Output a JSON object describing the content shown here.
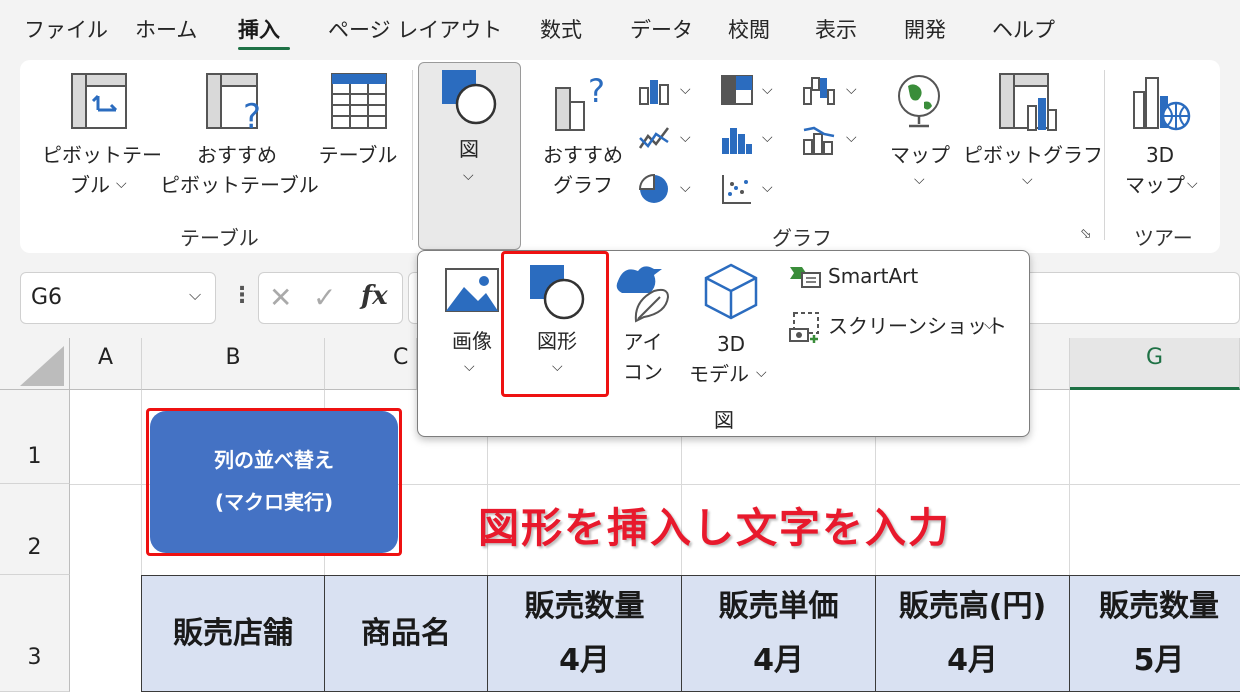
{
  "menu_tabs": [
    "ファイル",
    "ホーム",
    "挿入",
    "ページ レイアウト",
    "数式",
    "データ",
    "校閲",
    "表示",
    "開発",
    "ヘルプ"
  ],
  "active_tab": "挿入",
  "ribbon": {
    "table_group": {
      "label": "テーブル",
      "pivot_table_line1": "ピボットテー",
      "pivot_table_line2": "ブル",
      "recommended_pivot_line1": "おすすめ",
      "recommended_pivot_line2": "ピボットテーブル",
      "table": "テーブル"
    },
    "illustrations_button": "図",
    "chart_group": {
      "label": "グラフ",
      "recommended_line1": "おすすめ",
      "recommended_line2": "グラフ",
      "map": "マップ",
      "pivot_chart": "ピボットグラフ"
    },
    "tour_group": {
      "label": "ツアー",
      "map3d_line1": "3D",
      "map3d_line2": "マップ"
    }
  },
  "dropdown": {
    "image": "画像",
    "shapes": "図形",
    "icons_line1": "アイ",
    "icons_line2": "コン",
    "model3d_line1": "3D",
    "model3d_line2": "モデル",
    "smartart": "SmartArt",
    "screenshot": "スクリーンショット",
    "group_label": "図"
  },
  "formula_bar": {
    "name_box": "G6",
    "fx": "fx"
  },
  "columns": [
    "A",
    "B",
    "C",
    "G"
  ],
  "rows": [
    "1",
    "2",
    "3"
  ],
  "macro_button": {
    "line1": "列の並べ替え",
    "line2": "(マクロ実行)"
  },
  "annotation": "図形を挿入し文字を入力",
  "table_headers": [
    {
      "line1": "販売店舗",
      "line2": ""
    },
    {
      "line1": "商品名",
      "line2": ""
    },
    {
      "line1": "販売数量",
      "line2": "4月"
    },
    {
      "line1": "販売単価",
      "line2": "4月"
    },
    {
      "line1": "販売高(円)",
      "line2": "4月"
    },
    {
      "line1": "販売数量",
      "line2": "5月"
    }
  ],
  "colors": {
    "accent_green": "#1e7145",
    "highlight_red": "#ee1111",
    "macro_blue": "#4472c4",
    "header_fill": "#d9e1f2"
  }
}
